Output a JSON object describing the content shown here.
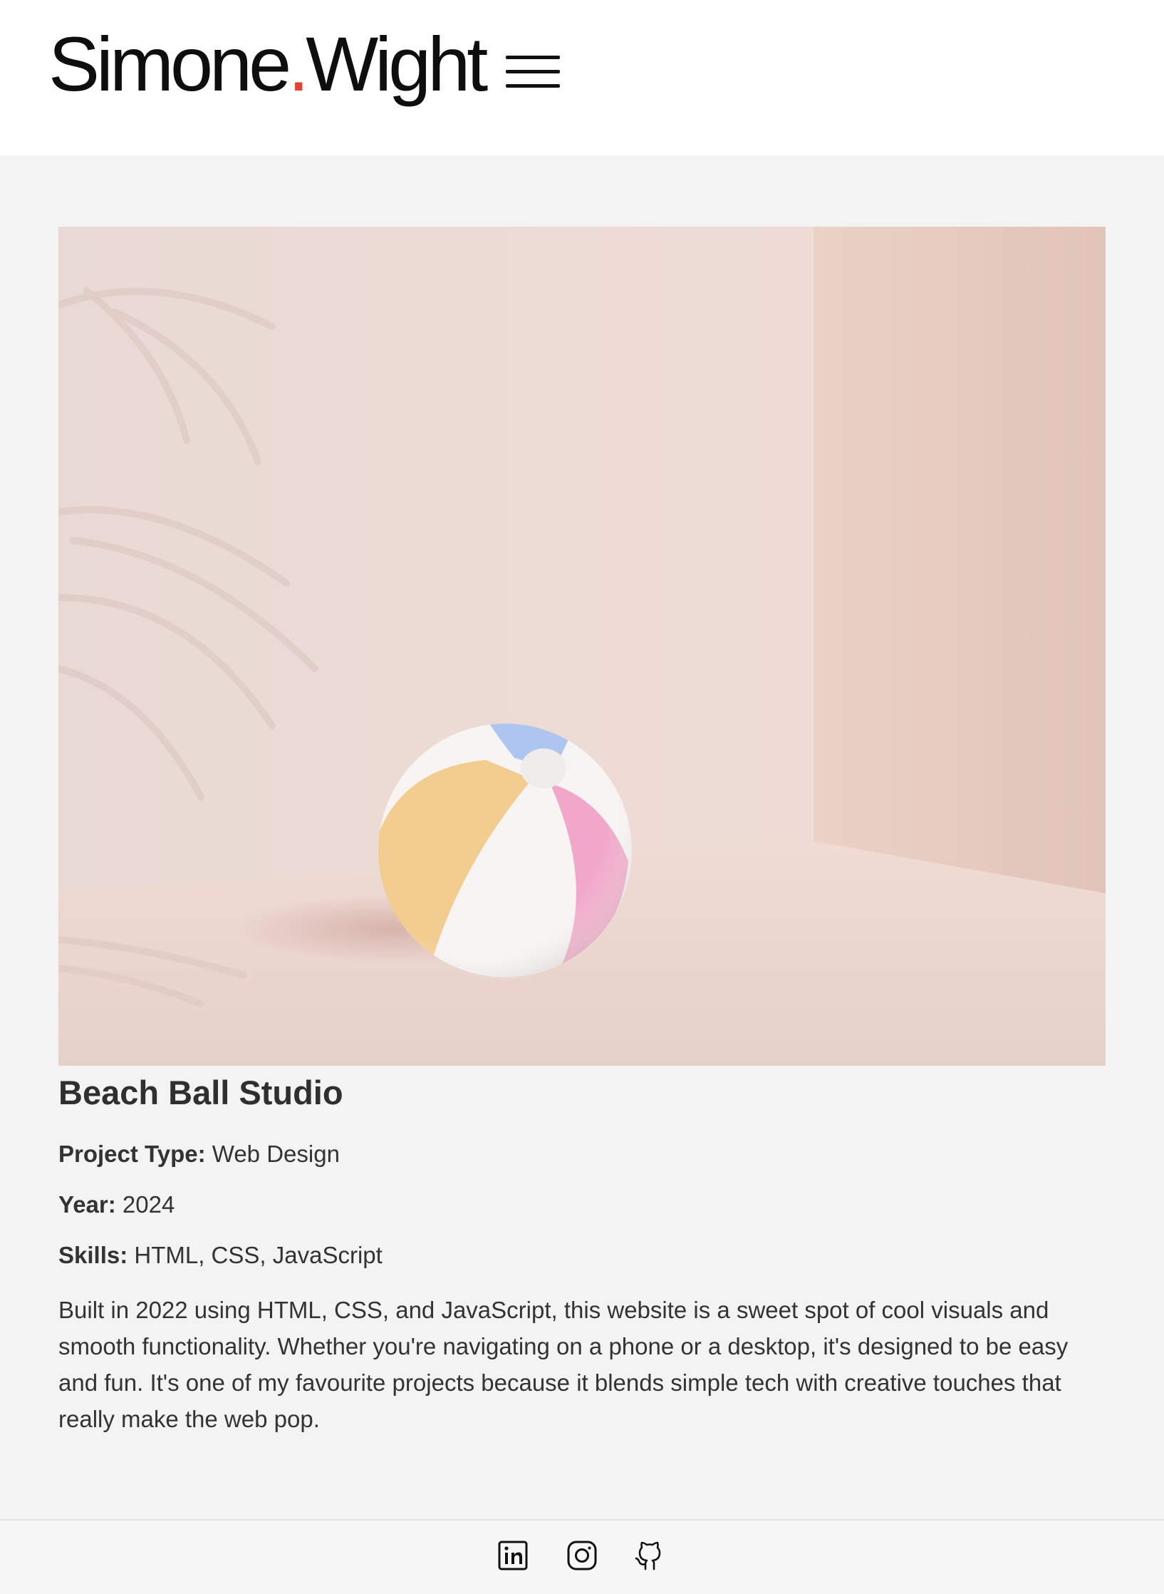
{
  "header": {
    "logo_first": "Simone",
    "logo_dot": ".",
    "logo_last": "Wight",
    "menu_icon": "hamburger-menu-icon"
  },
  "hero_image": {
    "subject": "beach-ball-image",
    "colors": {
      "background": "#ecdad4",
      "ball_yellow": "#f2c98a",
      "ball_pink": "#f1a6c8",
      "ball_blue": "#a9c4ef"
    }
  },
  "project": {
    "title": "Beach Ball Studio",
    "type_label": "Project Type:",
    "type_value": "Web Design",
    "year_label": "Year:",
    "year_value": "2024",
    "skills_label": "Skills:",
    "skills_value": "HTML, CSS, JavaScript",
    "description": "Built in 2022 using HTML, CSS, and JavaScript, this website is a sweet spot of cool visuals and smooth functionality. Whether you're navigating on a phone or a desktop, it's designed to be easy and fun. It's one of my favourite projects because it blends simple tech with creative touches that really make the web pop."
  },
  "footer": {
    "icons": [
      "linkedin-icon",
      "instagram-icon",
      "github-icon"
    ]
  },
  "colors": {
    "accent": "#e0432f",
    "text": "#2f2f2f",
    "page_bg": "#f3f3f3"
  }
}
